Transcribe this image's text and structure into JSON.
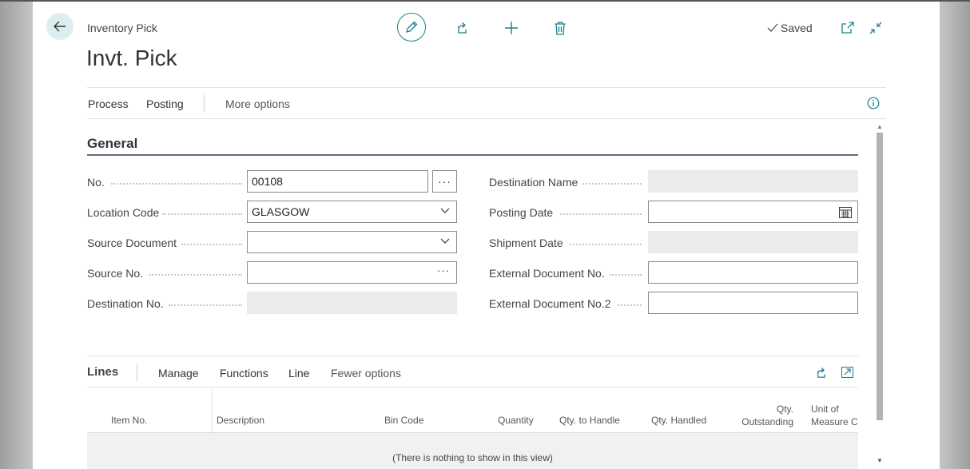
{
  "window": {
    "breadcrumb": "Inventory Pick",
    "title": "Invt. Pick",
    "status": "Saved"
  },
  "actions": {
    "process": "Process",
    "posting": "Posting",
    "more": "More options"
  },
  "general": {
    "title": "General",
    "left_fields": [
      {
        "label": "No.",
        "value": "00108"
      },
      {
        "label": "Location Code",
        "value": "GLASGOW"
      },
      {
        "label": "Source Document",
        "value": ""
      },
      {
        "label": "Source No.",
        "value": ""
      },
      {
        "label": "Destination No.",
        "value": ""
      }
    ],
    "right_fields": [
      {
        "label": "Destination Name",
        "value": ""
      },
      {
        "label": "Posting Date",
        "value": ""
      },
      {
        "label": "Shipment Date",
        "value": ""
      },
      {
        "label": "External Document No.",
        "value": ""
      },
      {
        "label": "External Document No.2",
        "value": ""
      }
    ]
  },
  "lines": {
    "title": "Lines",
    "actions": {
      "manage": "Manage",
      "functions": "Functions",
      "line": "Line",
      "fewer": "Fewer options"
    },
    "columns": [
      "Item No.",
      "Description",
      "Bin Code",
      "Quantity",
      "Qty. to Handle",
      "Qty. Handled",
      "Qty.",
      "Outstanding",
      "Unit of",
      "Measure Co"
    ],
    "empty_text": "(There is nothing to show in this view)"
  },
  "colors": {
    "accent": "#1d7f8c",
    "readonly_bg": "#ebebeb",
    "section_rule": "#606d80"
  },
  "icons": [
    "back-arrow-icon",
    "pencil-icon",
    "share-icon",
    "plus-icon",
    "trash-icon",
    "checkmark-icon",
    "popout-icon",
    "collapse-icon",
    "info-icon",
    "calendar-icon",
    "chevron-down-icon",
    "ellipsis-icon",
    "expand-icon"
  ]
}
